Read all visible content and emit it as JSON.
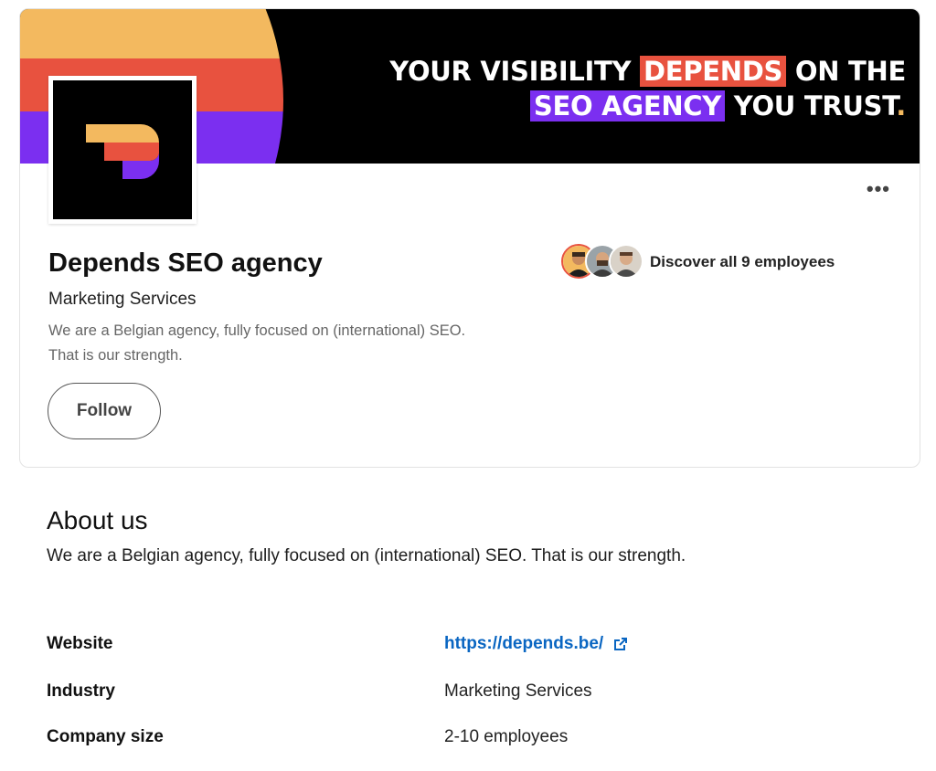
{
  "banner": {
    "line1_a": "YOUR VISIBILITY",
    "line1_highlight": "DEPENDS",
    "line1_b": "ON THE",
    "line2_highlight": "SEO AGENCY",
    "line2_b": "YOU TRUST",
    "period": ".",
    "stripe_colors": [
      "#f3b95f",
      "#e8523f",
      "#7b2ff0"
    ]
  },
  "company": {
    "name": "Depends SEO agency",
    "industry": "Marketing Services",
    "tagline_line1": "We are a Belgian agency, fully focused on (international) SEO.",
    "tagline_line2": "That is our strength.",
    "follow_label": "Follow",
    "more_label": "•••"
  },
  "employees": {
    "label": "Discover all 9 employees"
  },
  "about": {
    "title": "About us",
    "description": "We are a Belgian agency, fully focused on (international) SEO. That is our strength.",
    "rows": [
      {
        "label": "Website",
        "value": "https://depends.be/"
      },
      {
        "label": "Industry",
        "value": "Marketing Services"
      },
      {
        "label": "Company size",
        "value": "2-10 employees"
      }
    ]
  },
  "colors": {
    "link": "#0a66c2",
    "orange": "#f3b95f",
    "red": "#e8523f",
    "purple": "#7b2ff0"
  }
}
